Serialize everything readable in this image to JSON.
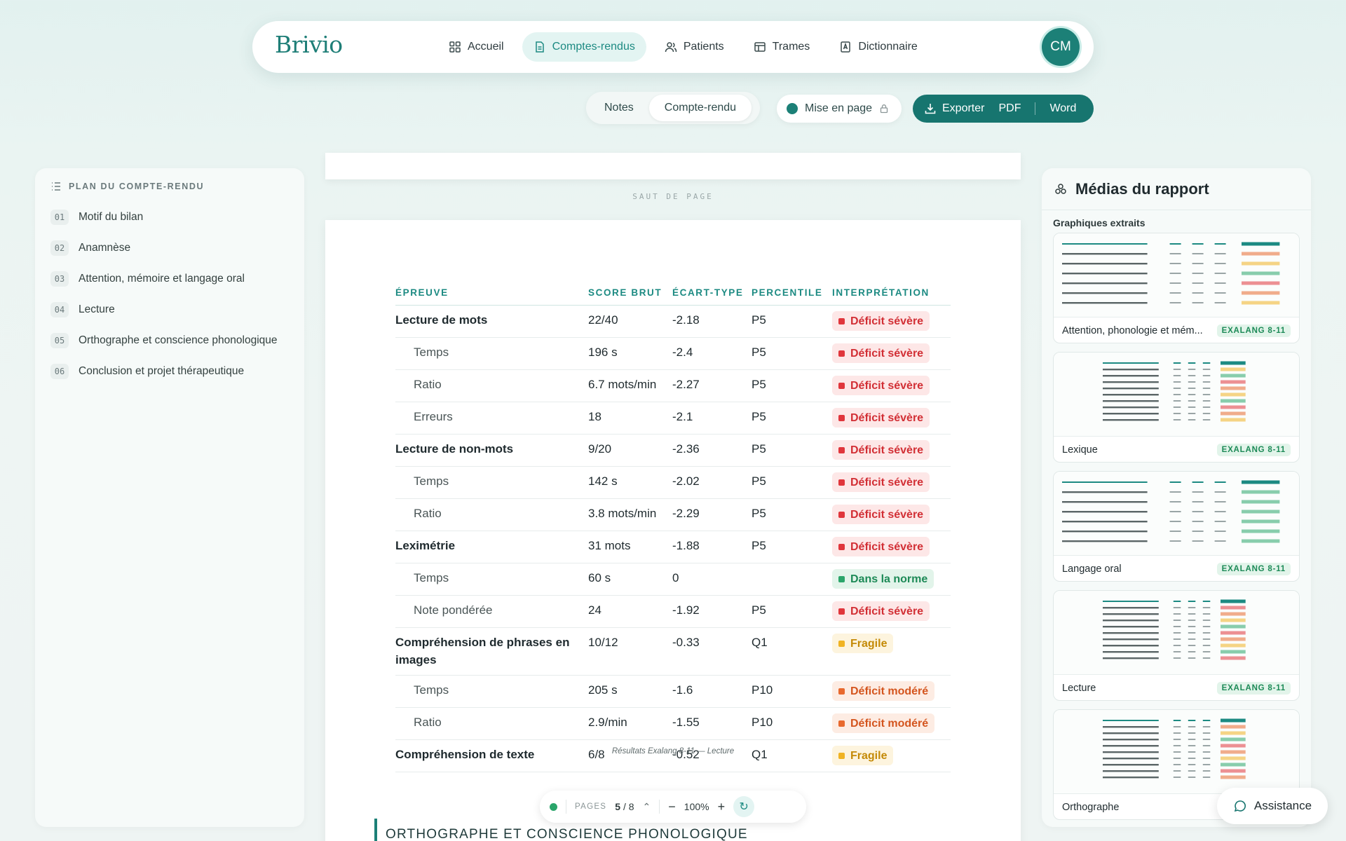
{
  "app": {
    "logo": "Brivio",
    "avatar_initials": "CM"
  },
  "nav": [
    {
      "label": "Accueil",
      "icon": "grid-icon"
    },
    {
      "label": "Comptes-rendus",
      "icon": "document-icon",
      "active": true
    },
    {
      "label": "Patients",
      "icon": "users-icon"
    },
    {
      "label": "Trames",
      "icon": "layout-icon"
    },
    {
      "label": "Dictionnaire",
      "icon": "book-icon"
    }
  ],
  "modes": {
    "notes": "Notes",
    "report": "Compte-rendu",
    "active": "Compte-rendu"
  },
  "layout_toggle": "Mise en page",
  "export": {
    "label": "Exporter",
    "pdf": "PDF",
    "word": "Word"
  },
  "outline": {
    "title": "PLAN DU COMPTE-RENDU",
    "items": [
      {
        "num": "01",
        "label": "Motif du bilan"
      },
      {
        "num": "02",
        "label": "Anamnèse"
      },
      {
        "num": "03",
        "label": "Attention, mémoire et langage oral"
      },
      {
        "num": "04",
        "label": "Lecture"
      },
      {
        "num": "05",
        "label": "Orthographe et conscience phonologique"
      },
      {
        "num": "06",
        "label": "Conclusion et projet thérapeutique"
      }
    ]
  },
  "page_break": "SAUT DE PAGE",
  "table": {
    "headers": [
      "ÉPREUVE",
      "SCORE BRUT",
      "ÉCART-TYPE",
      "PERCENTILE",
      "INTERPRÉTATION"
    ],
    "rows": [
      {
        "type": "main",
        "label": "Lecture de mots",
        "score": "22/40",
        "sd": "-2.18",
        "pct": "P5",
        "interp": "Déficit sévère",
        "level": "sev"
      },
      {
        "type": "sub",
        "label": "Temps",
        "score": "196 s",
        "sd": "-2.4",
        "pct": "P5",
        "interp": "Déficit sévère",
        "level": "sev"
      },
      {
        "type": "sub",
        "label": "Ratio",
        "score": "6.7 mots/min",
        "sd": "-2.27",
        "pct": "P5",
        "interp": "Déficit sévère",
        "level": "sev"
      },
      {
        "type": "sub",
        "label": "Erreurs",
        "score": "18",
        "sd": "-2.1",
        "pct": "P5",
        "interp": "Déficit sévère",
        "level": "sev"
      },
      {
        "type": "main",
        "label": "Lecture de non-mots",
        "score": "9/20",
        "sd": "-2.36",
        "pct": "P5",
        "interp": "Déficit sévère",
        "level": "sev"
      },
      {
        "type": "sub",
        "label": "Temps",
        "score": "142 s",
        "sd": "-2.02",
        "pct": "P5",
        "interp": "Déficit sévère",
        "level": "sev"
      },
      {
        "type": "sub",
        "label": "Ratio",
        "score": "3.8 mots/min",
        "sd": "-2.29",
        "pct": "P5",
        "interp": "Déficit sévère",
        "level": "sev"
      },
      {
        "type": "main",
        "label": "Leximétrie",
        "score": "31 mots",
        "sd": "-1.88",
        "pct": "P5",
        "interp": "Déficit sévère",
        "level": "sev"
      },
      {
        "type": "sub",
        "label": "Temps",
        "score": "60 s",
        "sd": "0",
        "pct": "",
        "interp": "Dans la norme",
        "level": "norm"
      },
      {
        "type": "sub",
        "label": "Note pondérée",
        "score": "24",
        "sd": "-1.92",
        "pct": "P5",
        "interp": "Déficit sévère",
        "level": "sev"
      },
      {
        "type": "main",
        "label": "Compréhension de phrases en images",
        "score": "10/12",
        "sd": "-0.33",
        "pct": "Q1",
        "interp": "Fragile",
        "level": "fra"
      },
      {
        "type": "sub",
        "label": "Temps",
        "score": "205 s",
        "sd": "-1.6",
        "pct": "P10",
        "interp": "Déficit modéré",
        "level": "mod"
      },
      {
        "type": "sub",
        "label": "Ratio",
        "score": "2.9/min",
        "sd": "-1.55",
        "pct": "P10",
        "interp": "Déficit modéré",
        "level": "mod"
      },
      {
        "type": "main",
        "label": "Compréhension de texte",
        "score": "6/8",
        "sd": "-0.52",
        "pct": "Q1",
        "interp": "Fragile",
        "level": "fra"
      }
    ],
    "caption": "Résultats Exalang 8-11 — Lecture"
  },
  "next_section": "ORTHOGRAPHE ET CONSCIENCE PHONOLOGIQUE",
  "pager": {
    "label": "PAGES",
    "current": "5",
    "total": "8",
    "zoom": "100%"
  },
  "media": {
    "title": "Médias du rapport",
    "subtitle": "Graphiques extraits",
    "cards": [
      {
        "title": "Attention, phonologie et mém...",
        "tag": "EXALANG 8-11"
      },
      {
        "title": "Lexique",
        "tag": "EXALANG 8-11"
      },
      {
        "title": "Langage oral",
        "tag": "EXALANG 8-11"
      },
      {
        "title": "Lecture",
        "tag": "EXALANG 8-11"
      },
      {
        "title": "Orthographe",
        "tag": ""
      }
    ]
  },
  "assistant": "Assistance"
}
